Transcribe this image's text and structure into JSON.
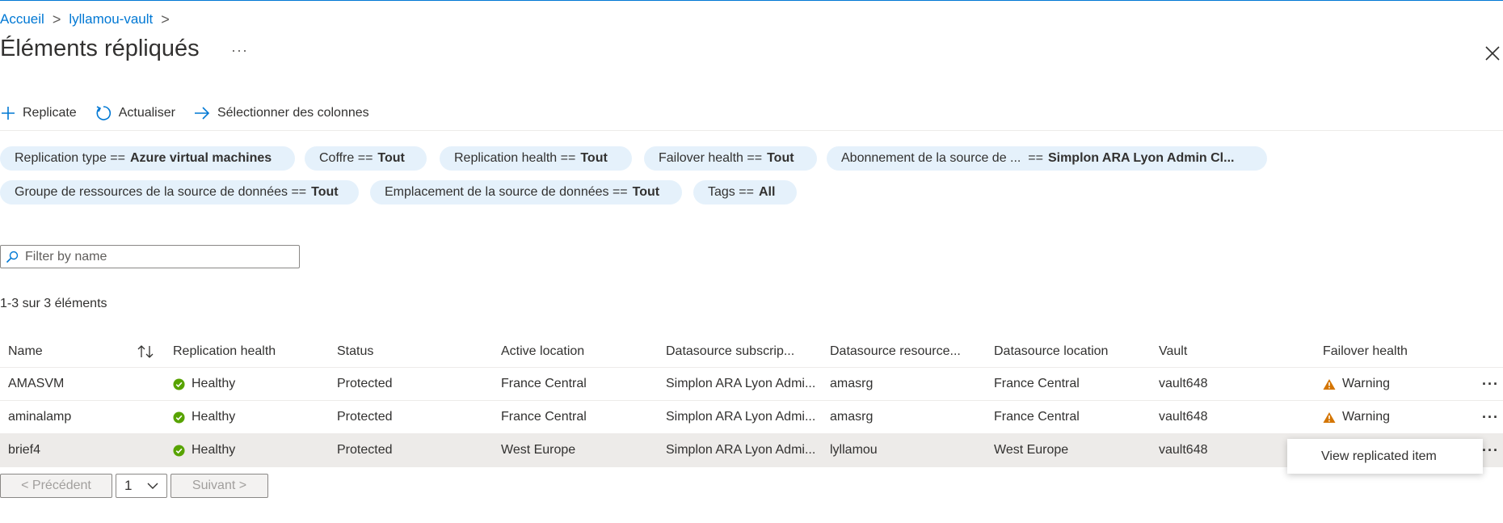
{
  "breadcrumb": {
    "home": "Accueil",
    "vault": "lyllamou-vault",
    "sep": ">"
  },
  "page": {
    "title": "Éléments répliqués",
    "more": "···"
  },
  "toolbar": {
    "replicate": "Replicate",
    "refresh": "Actualiser",
    "columns": "Sélectionner des colonnes"
  },
  "filters": [
    {
      "label": "Replication type ==",
      "value": "Azure virtual machines"
    },
    {
      "label": "Coffre ==",
      "value": "Tout"
    },
    {
      "label": "Replication health ==",
      "value": "Tout"
    },
    {
      "label": "Failover health ==",
      "value": "Tout"
    },
    {
      "label": "Abonnement de la source de ...  ==",
      "value": "Simplon ARA Lyon Admin Cl..."
    },
    {
      "label": "Groupe de ressources de la source de données ==",
      "value": "Tout"
    },
    {
      "label": "Emplacement de la source de données ==",
      "value": "Tout"
    },
    {
      "label": "Tags ==",
      "value": "All"
    }
  ],
  "search": {
    "placeholder": "Filter by name"
  },
  "count_text": "1-3 sur 3 éléments",
  "table": {
    "headers": [
      "Name",
      "Replication health",
      "Status",
      "Active location",
      "Datasource subscrip...",
      "Datasource resource...",
      "Datasource location",
      "Vault",
      "Failover health"
    ],
    "rows": [
      {
        "name": "AMASVM",
        "health": "Healthy",
        "status": "Protected",
        "active": "France Central",
        "sub": "Simplon ARA Lyon Admi...",
        "rg": "amasrg",
        "loc": "France Central",
        "vault": "vault648",
        "failover": "Warning"
      },
      {
        "name": "aminalamp",
        "health": "Healthy",
        "status": "Protected",
        "active": "France Central",
        "sub": "Simplon ARA Lyon Admi...",
        "rg": "amasrg",
        "loc": "France Central",
        "vault": "vault648",
        "failover": "Warning"
      },
      {
        "name": "brief4",
        "health": "Healthy",
        "status": "Protected",
        "active": "West Europe",
        "sub": "Simplon ARA Lyon Admi...",
        "rg": "lyllamou",
        "loc": "West Europe",
        "vault": "vault648",
        "failover": ""
      }
    ],
    "row_more": "···"
  },
  "context_menu": {
    "item": "View replicated item"
  },
  "pager": {
    "prev": "< Précédent",
    "page": "1",
    "next": "Suivant >"
  },
  "colors": {
    "accent": "#0078d4",
    "pill_bg": "#e5f1fb",
    "healthy": "#57a300",
    "warning": "#d47500",
    "selected_row": "#edebe9"
  },
  "icons": {
    "replicate": "plus-icon",
    "refresh": "refresh-icon",
    "columns": "arrow-right-icon",
    "search": "search-icon",
    "close": "close-icon",
    "sort": "sort-icon",
    "healthy": "check-circle-icon",
    "warning": "warning-triangle-icon",
    "dropdown": "chevron-down-icon"
  }
}
